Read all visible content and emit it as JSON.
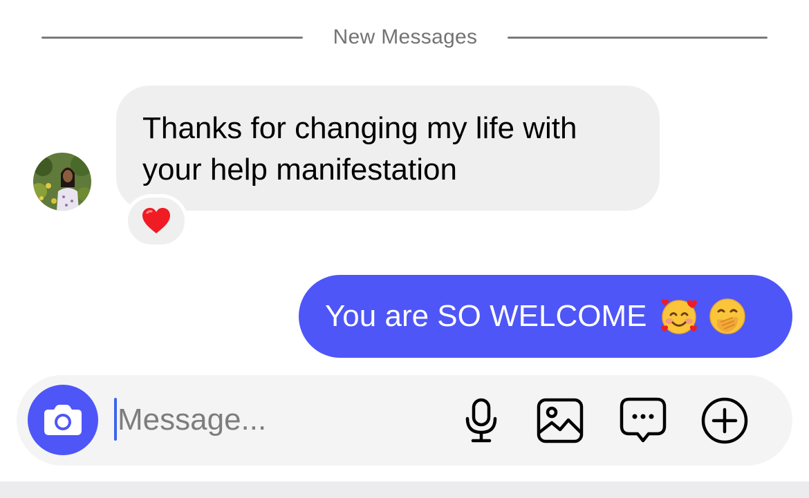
{
  "divider": {
    "label": "New Messages"
  },
  "messages": [
    {
      "direction": "incoming",
      "lines": [
        "Thanks for changing my life with",
        "your help manifestation"
      ],
      "reaction": "heart-emoji"
    },
    {
      "direction": "outgoing",
      "text": "You are SO WELCOME",
      "emojis": [
        "smiling-face-with-hearts-emoji",
        "face-with-hand-over-mouth-emoji"
      ]
    }
  ],
  "composer": {
    "placeholder": "Message...",
    "icons": [
      "camera-icon",
      "microphone-icon",
      "gallery-icon",
      "sticker-icon",
      "plus-icon"
    ]
  },
  "colors": {
    "accent": "#4e56f7",
    "incoming_bubble": "#efefef",
    "composer_bg": "#f4f4f4",
    "caret": "#3a64f2"
  }
}
